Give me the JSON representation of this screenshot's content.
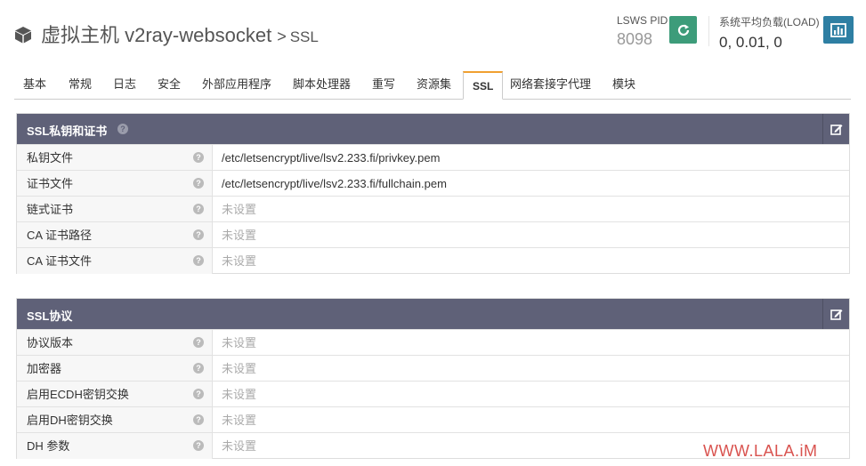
{
  "header": {
    "title": "虚拟主机 v2ray-websocket",
    "separator": ">",
    "subtitle": "SSL",
    "pid_label": "LSWS PID",
    "pid_value": "8098",
    "load_label": "系统平均负载(LOAD)",
    "load_value": "0, 0.01, 0"
  },
  "tabs": [
    {
      "label": "基本",
      "active": false
    },
    {
      "label": "常规",
      "active": false
    },
    {
      "label": "日志",
      "active": false
    },
    {
      "label": "安全",
      "active": false
    },
    {
      "label": "外部应用程序",
      "active": false
    },
    {
      "label": "脚本处理器",
      "active": false
    },
    {
      "label": "重写",
      "active": false
    },
    {
      "label": "资源集",
      "active": false
    },
    {
      "label": "SSL",
      "active": true
    },
    {
      "label": "网络套接字代理",
      "active": false
    },
    {
      "label": "模块",
      "active": false
    }
  ],
  "panels": [
    {
      "title": "SSL私钥和证书",
      "rows": [
        {
          "label": "私钥文件",
          "value": "/etc/letsencrypt/live/lsv2.233.fi/privkey.pem",
          "unset": false
        },
        {
          "label": "证书文件",
          "value": "/etc/letsencrypt/live/lsv2.233.fi/fullchain.pem",
          "unset": false
        },
        {
          "label": "链式证书",
          "value": "未设置",
          "unset": true
        },
        {
          "label": "CA 证书路径",
          "value": "未设置",
          "unset": true
        },
        {
          "label": "CA 证书文件",
          "value": "未设置",
          "unset": true
        }
      ]
    },
    {
      "title": "SSL协议",
      "rows": [
        {
          "label": "协议版本",
          "value": "未设置",
          "unset": true
        },
        {
          "label": "加密器",
          "value": "未设置",
          "unset": true
        },
        {
          "label": "启用ECDH密钥交换",
          "value": "未设置",
          "unset": true
        },
        {
          "label": "启用DH密钥交换",
          "value": "未设置",
          "unset": true
        },
        {
          "label": "DH 参数",
          "value": "未设置",
          "unset": true
        }
      ]
    }
  ],
  "help_glyph": "?",
  "watermark": "WWW.LALA.iM",
  "colors": {
    "panel_header": "#5f6178",
    "restart_button": "#3d9c7a",
    "stats_button": "#2e7fa3",
    "active_tab_accent": "#f0a030",
    "unset_text": "#aaaaaa",
    "watermark": "#d9534f"
  }
}
